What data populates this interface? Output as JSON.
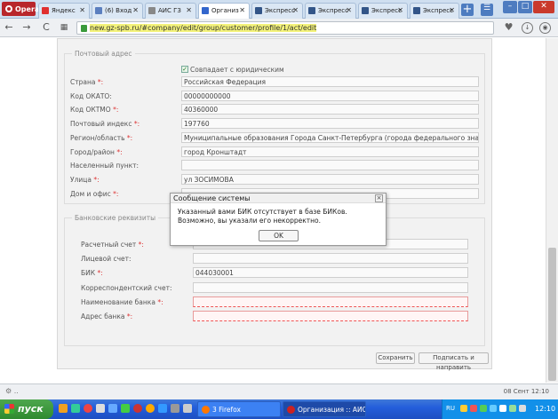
{
  "browser": {
    "opera_label": "Opera",
    "tabs": [
      {
        "label": "Яндекс",
        "icon_color": "#e03030"
      },
      {
        "label": "(6) Вход",
        "icon_color": "#5b7fbf"
      },
      {
        "label": "АИС ГЗ",
        "icon_color": "#888888"
      },
      {
        "label": "Организ",
        "icon_color": "#3366cc"
      },
      {
        "label": "Экспресс",
        "icon_color": "#335588"
      },
      {
        "label": "Экспресс",
        "icon_color": "#335588"
      },
      {
        "label": "Экспресс",
        "icon_color": "#335588"
      },
      {
        "label": "Экспресс",
        "icon_color": "#335588"
      }
    ],
    "new_tab": "+",
    "url": "new.gz-spb.ru/#company/edit/group/customer/profile/1/act/edit"
  },
  "postal": {
    "legend": "Почтовый адрес",
    "same_as_legal": "Совпадает с юридическим",
    "fields": [
      {
        "label": "Страна ",
        "req": "*:",
        "value": "Российская Федерация"
      },
      {
        "label": "Код ОКАТО:",
        "req": "",
        "value": "00000000000"
      },
      {
        "label": "Код ОКТМО ",
        "req": "*:",
        "value": "40360000"
      },
      {
        "label": "Почтовый индекс ",
        "req": "*:",
        "value": "197760"
      },
      {
        "label": "Регион/область ",
        "req": "*:",
        "value": "Муниципальные образования Города Санкт-Петербурга (города федерального значения)"
      },
      {
        "label": "Город/район ",
        "req": "*:",
        "value": "город Кронштадт"
      },
      {
        "label": "Населенный пункт:",
        "req": "",
        "value": ""
      },
      {
        "label": "Улица ",
        "req": "*:",
        "value": "ул ЗОСИМОВА"
      },
      {
        "label": "Дом и офис ",
        "req": "*:",
        "value": ""
      }
    ]
  },
  "bank": {
    "legend": "Банковские реквизиты",
    "fields": [
      {
        "label": "Расчетный счет ",
        "req": "*:",
        "value": ""
      },
      {
        "label": "Лицевой счет:",
        "req": "",
        "value": ""
      },
      {
        "label": "БИК ",
        "req": "*:",
        "value": "044030001"
      },
      {
        "label": "Корреспондентский счет:",
        "req": "",
        "value": ""
      },
      {
        "label": "Наименование банка ",
        "req": "*:",
        "value": ""
      },
      {
        "label": "Адрес банка ",
        "req": "*:",
        "value": ""
      }
    ]
  },
  "buttons": {
    "save": "Сохранить",
    "sign_send": "Подписать и направить"
  },
  "dialog": {
    "title": "Сообщение системы",
    "message": "Указанный вами БИК отсутствует в базе БИКов. Возможно, вы указали его некорректно.",
    "ok": "OK"
  },
  "status": {
    "date": "08 Сент 12:10"
  },
  "taskbar": {
    "start": "пуск",
    "firefox": "3 Firefox",
    "opera_task": "Организация :: АИС ...",
    "lang": "RU",
    "clock": "12:10"
  }
}
